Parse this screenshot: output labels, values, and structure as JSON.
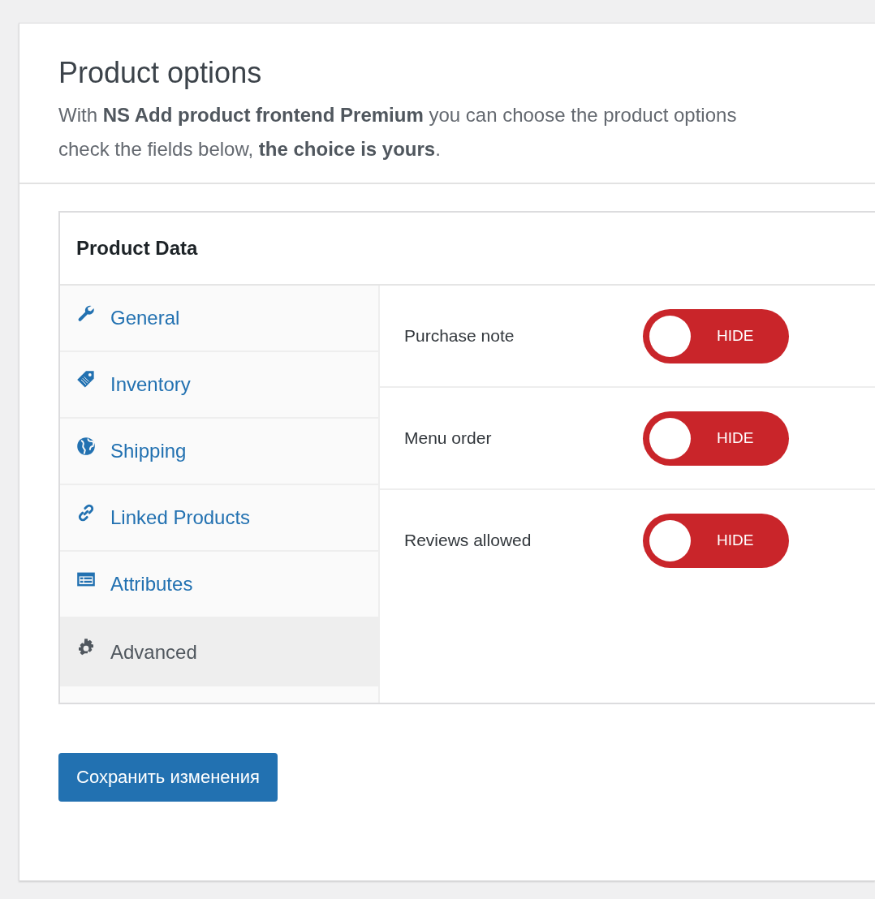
{
  "header": {
    "title": "Product options",
    "intro": "With **NS Add product frontend Premium** you can choose the product options\ncheck the fields below, **the choice is yours**."
  },
  "panel": {
    "title": "Product Data",
    "tabs": [
      {
        "label": "General",
        "selected": false
      },
      {
        "label": "Inventory",
        "selected": false
      },
      {
        "label": "Shipping",
        "selected": false
      },
      {
        "label": "Linked Products",
        "selected": false
      },
      {
        "label": "Attributes",
        "selected": false
      },
      {
        "label": "Advanced",
        "selected": true
      }
    ],
    "options": [
      {
        "label": "Purchase note",
        "on": false,
        "toggle_text": "HIDE"
      },
      {
        "label": "Menu order",
        "on": false,
        "toggle_text": "HIDE"
      },
      {
        "label": "Reviews allowed",
        "on": false,
        "toggle_text": "HIDE"
      }
    ]
  },
  "save_button": "Сохранить изменения"
}
